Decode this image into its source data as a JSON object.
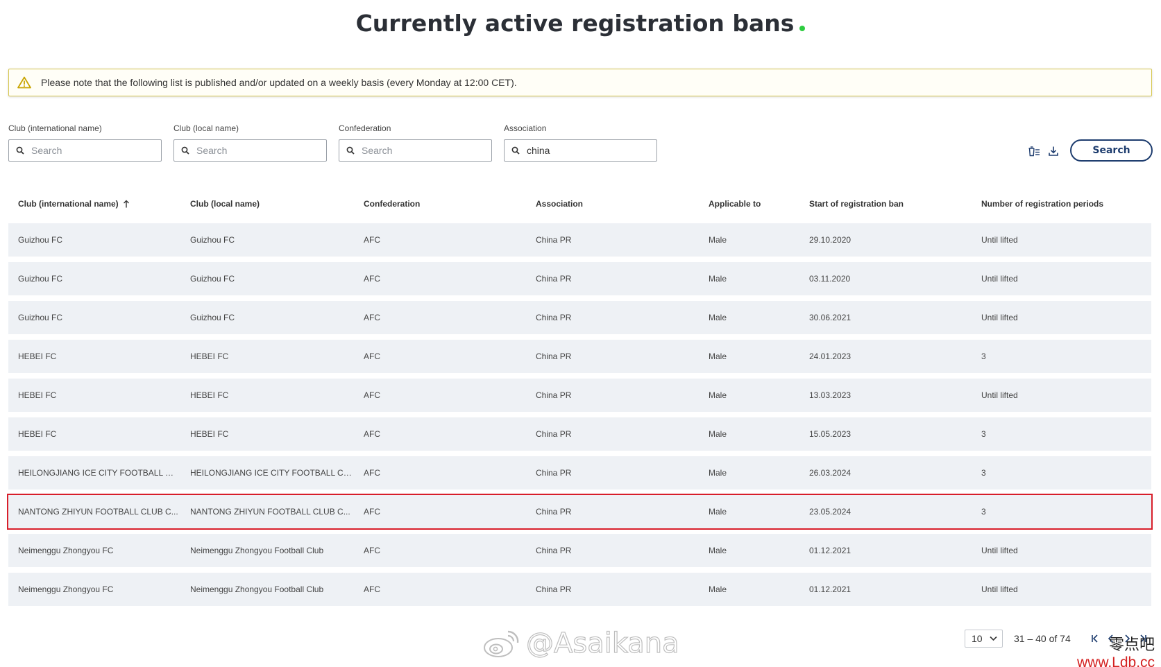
{
  "page": {
    "title": "Currently active registration bans"
  },
  "notice": {
    "text": "Please note that the following list is published and/or updated on a weekly basis (every Monday at 12:00 CET)."
  },
  "filters": {
    "club_international": {
      "label": "Club (international name)",
      "placeholder": "Search",
      "value": ""
    },
    "club_local": {
      "label": "Club (local name)",
      "placeholder": "Search",
      "value": ""
    },
    "confederation": {
      "label": "Confederation",
      "placeholder": "Search",
      "value": ""
    },
    "association": {
      "label": "Association",
      "placeholder": "Search",
      "value": "china"
    }
  },
  "toolbar": {
    "clear_icon": "clear-filter-icon",
    "download_icon": "download-icon",
    "search_label": "Search"
  },
  "table": {
    "columns": [
      "Club (international name)",
      "Club (local name)",
      "Confederation",
      "Association",
      "Applicable to",
      "Start of registration ban",
      "Number of registration periods"
    ],
    "sorted_column": "Club (international name)",
    "sort_direction": "ascending",
    "rows": [
      [
        "Guizhou FC",
        "Guizhou FC",
        "AFC",
        "China PR",
        "Male",
        "29.10.2020",
        "Until lifted"
      ],
      [
        "Guizhou FC",
        "Guizhou FC",
        "AFC",
        "China PR",
        "Male",
        "03.11.2020",
        "Until lifted"
      ],
      [
        "Guizhou FC",
        "Guizhou FC",
        "AFC",
        "China PR",
        "Male",
        "30.06.2021",
        "Until lifted"
      ],
      [
        "HEBEI FC",
        "HEBEI FC",
        "AFC",
        "China PR",
        "Male",
        "24.01.2023",
        "3"
      ],
      [
        "HEBEI FC",
        "HEBEI FC",
        "AFC",
        "China PR",
        "Male",
        "13.03.2023",
        "Until lifted"
      ],
      [
        "HEBEI FC",
        "HEBEI FC",
        "AFC",
        "China PR",
        "Male",
        "15.05.2023",
        "3"
      ],
      [
        "HEILONGJIANG ICE CITY FOOTBALL CL...",
        "HEILONGJIANG ICE CITY FOOTBALL CL...",
        "AFC",
        "China PR",
        "Male",
        "26.03.2024",
        "3"
      ],
      [
        "NANTONG ZHIYUN FOOTBALL CLUB C...",
        "NANTONG ZHIYUN FOOTBALL CLUB C...",
        "AFC",
        "China PR",
        "Male",
        "23.05.2024",
        "3"
      ],
      [
        "Neimenggu Zhongyou FC",
        "Neimenggu Zhongyou Football Club",
        "AFC",
        "China PR",
        "Male",
        "01.12.2021",
        "Until lifted"
      ],
      [
        "Neimenggu Zhongyou FC",
        "Neimenggu Zhongyou Football Club",
        "AFC",
        "China PR",
        "Male",
        "01.12.2021",
        "Until lifted"
      ]
    ],
    "highlighted_row": 7
  },
  "pagination": {
    "page_size": "10",
    "range": "31 – 40 of 74"
  },
  "watermarks": {
    "handle": "@Asaikana",
    "site_name": "零点吧",
    "site_url": "www.Ldb.cc"
  },
  "colors": {
    "title": "#2b2f36",
    "live_dot": "#2ecc40",
    "notice_border": "#d6c64e",
    "row_bg": "#eef1f5",
    "highlight": "#d81e2a",
    "button": "#1d3c6e"
  }
}
